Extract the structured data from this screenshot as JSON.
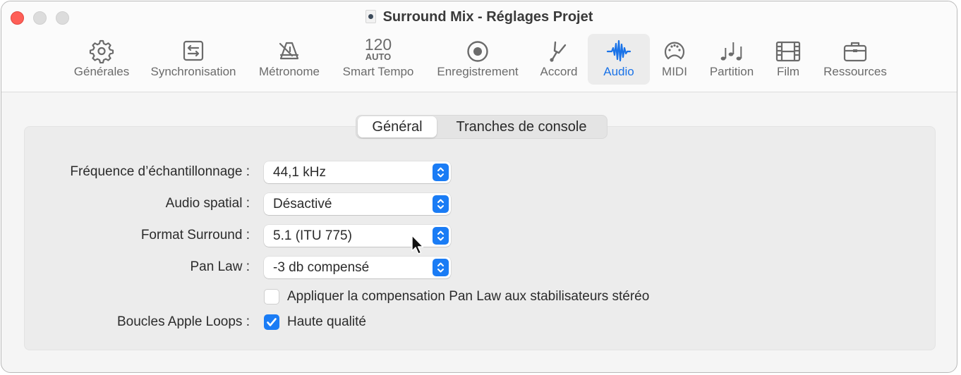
{
  "window": {
    "title": "Surround Mix - Réglages Projet",
    "traffic_lights": [
      "close",
      "minimize",
      "zoom"
    ]
  },
  "toolbar": {
    "active_color": "#1a73e8",
    "items": [
      {
        "label": "Générales",
        "icon": "gear-icon"
      },
      {
        "label": "Synchronisation",
        "icon": "sync-arrows-icon"
      },
      {
        "label": "Métronome",
        "icon": "metronome-icon"
      },
      {
        "label": "Smart Tempo",
        "icon": "tempo-readout",
        "tempo_value": "120",
        "tempo_mode": "AUTO"
      },
      {
        "label": "Enregistrement",
        "icon": "record-icon"
      },
      {
        "label": "Accord",
        "icon": "tuning-fork-icon"
      },
      {
        "label": "Audio",
        "icon": "waveform-icon",
        "active": true
      },
      {
        "label": "MIDI",
        "icon": "midi-connector-icon"
      },
      {
        "label": "Partition",
        "icon": "music-notes-icon"
      },
      {
        "label": "Film",
        "icon": "film-strip-icon"
      },
      {
        "label": "Ressources",
        "icon": "briefcase-icon"
      }
    ]
  },
  "tabs": [
    {
      "label": "Général",
      "active": true
    },
    {
      "label": "Tranches de console",
      "active": false
    }
  ],
  "settings": {
    "sample_rate": {
      "label": "Fréquence d’échantillonnage :",
      "value": "44,1 kHz"
    },
    "spatial_audio": {
      "label": "Audio spatial :",
      "value": "Désactivé"
    },
    "surround_format": {
      "label": "Format Surround :",
      "value": "5.1 (ITU 775)"
    },
    "pan_law": {
      "label": "Pan Law :",
      "value": "-3 db compensé"
    },
    "pan_law_compensation": {
      "label": "Appliquer la compensation Pan Law aux stabilisateurs stéréo",
      "checked": false
    },
    "apple_loops": {
      "label": "Boucles Apple Loops :",
      "option_label": "Haute qualité",
      "checked": true
    }
  },
  "accent_color": "#1a7cf5"
}
